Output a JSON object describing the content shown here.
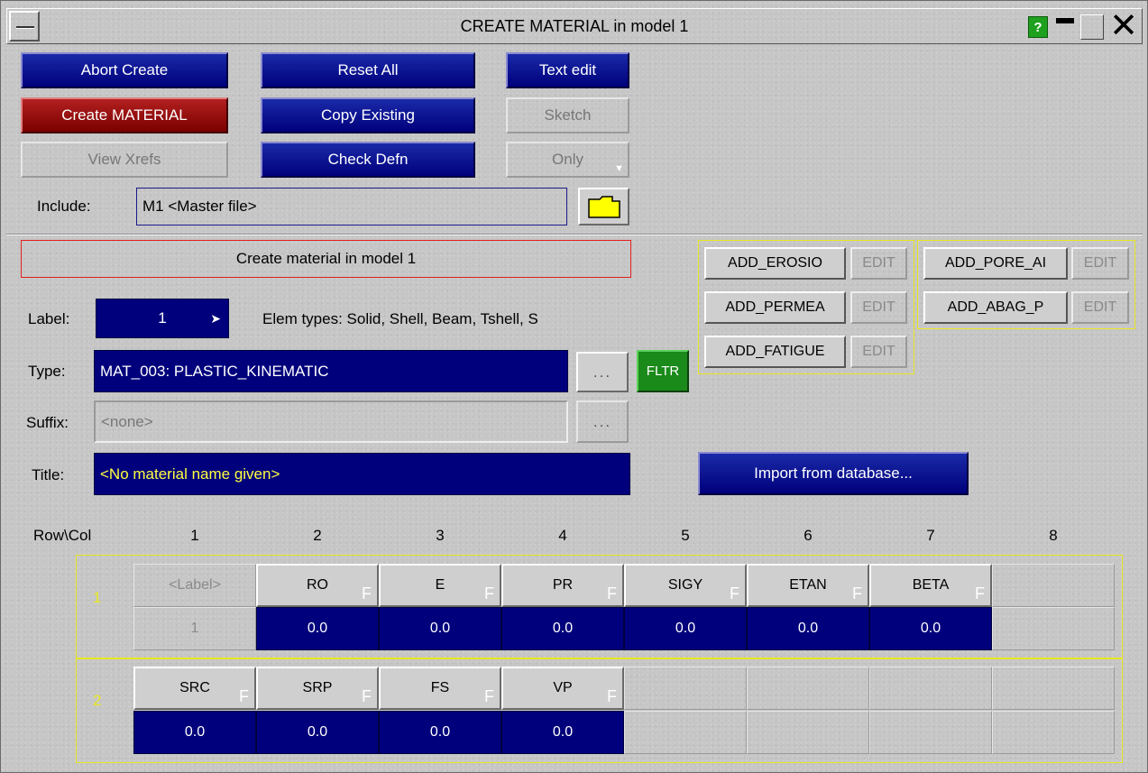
{
  "window": {
    "title": "CREATE MATERIAL in model 1",
    "help": "?"
  },
  "buttons": {
    "abort": "Abort Create",
    "reset": "Reset All",
    "text_edit": "Text edit",
    "create": "Create MATERIAL",
    "copy": "Copy Existing",
    "sketch": "Sketch",
    "view_xrefs": "View Xrefs",
    "check": "Check Defn",
    "only": "Only"
  },
  "include": {
    "label": "Include:",
    "value": "M1  <Master file>"
  },
  "status": "Create material in model 1",
  "label": {
    "caption": "Label:",
    "value": "1",
    "elem_types": "Elem types: Solid, Shell, Beam, Tshell, S"
  },
  "type": {
    "caption": "Type:",
    "value": "MAT_003: PLASTIC_KINEMATIC",
    "dots": "...",
    "fltr": "FLTR"
  },
  "suffix": {
    "caption": "Suffix:",
    "value": "<none>",
    "dots": "..."
  },
  "title_field": {
    "caption": "Title:",
    "value": "<No material name given>"
  },
  "import_button": "Import from database...",
  "add_cards": [
    {
      "label": "ADD_EROSIO",
      "edit": "EDIT"
    },
    {
      "label": "ADD_PERMEA",
      "edit": "EDIT"
    },
    {
      "label": "ADD_FATIGUE",
      "edit": "EDIT"
    },
    {
      "label": "ADD_PORE_AI",
      "edit": "EDIT"
    },
    {
      "label": "ADD_ABAG_P",
      "edit": "EDIT"
    }
  ],
  "grid": {
    "corner": "Row\\Col",
    "cols": [
      "1",
      "2",
      "3",
      "4",
      "5",
      "6",
      "7",
      "8"
    ],
    "flag": "F",
    "rows": [
      {
        "num": "1",
        "heads": [
          "<Label>",
          "RO",
          "E",
          "PR",
          "SIGY",
          "ETAN",
          "BETA"
        ],
        "values": [
          "1",
          "0.0",
          "0.0",
          "0.0",
          "0.0",
          "0.0",
          "0.0"
        ]
      },
      {
        "num": "2",
        "heads": [
          "SRC",
          "SRP",
          "FS",
          "VP"
        ],
        "values": [
          "0.0",
          "0.0",
          "0.0",
          "0.0"
        ]
      }
    ]
  },
  "colors": {
    "accent_blue": "#00007c",
    "create_red": "#9a1010",
    "fltr_green": "#1a8a1a",
    "grid_yellow": "#e8e820",
    "title_yellow": "#ffff40"
  }
}
